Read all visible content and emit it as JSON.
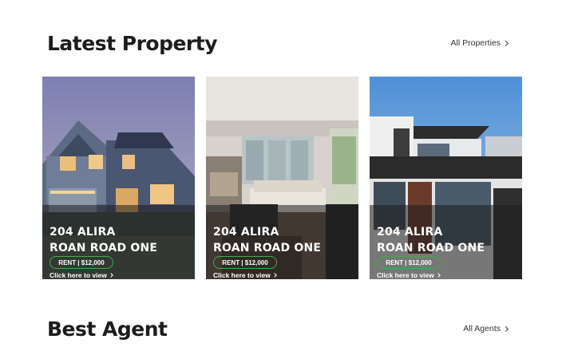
{
  "latest": {
    "title": "Latest Property",
    "view_all": "All Properties"
  },
  "properties": [
    {
      "line1": "204 ALIRA",
      "line2": "ROAN ROAD ONE",
      "badge": "RENT | $12,000",
      "link": "Click here to view",
      "photo": "house-exterior-dusk"
    },
    {
      "line1": "204 ALIRA",
      "line2": "ROAN ROAD ONE",
      "badge": "RENT | $12,000",
      "link": "Click here to view",
      "photo": "living-room-interior"
    },
    {
      "line1": "204 ALIRA",
      "line2": "ROAN ROAD ONE",
      "badge": "RENT | $12,000",
      "link": "Click here to view",
      "photo": "modern-building"
    }
  ],
  "agents": {
    "title": "Best Agent",
    "view_all": "All Agents"
  },
  "colors": {
    "badge_border": "#3fae49",
    "overlay": "#1e1e1e"
  }
}
